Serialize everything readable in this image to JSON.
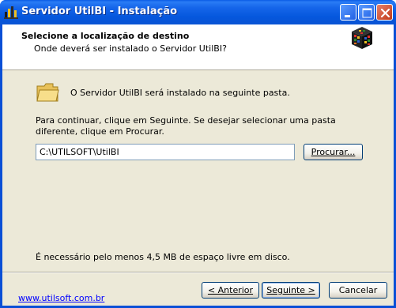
{
  "window": {
    "title": "Servidor UtilBI - Instalação"
  },
  "header": {
    "title": "Selecione a localização de destino",
    "subtitle": "Onde deverá ser instalado o Servidor UtilBI?"
  },
  "body": {
    "install_text": "O Servidor UtilBI será instalado na seguinte pasta.",
    "continue_text": "Para continuar, clique em Seguinte. Se desejar selecionar uma pasta diferente, clique em Procurar.",
    "path_value": "C:\\UTILSOFT\\UtilBI",
    "browse_label": "Procurar...",
    "space_text": "É necessário pelo menos 4,5 MB de espaço livre em disco."
  },
  "footer": {
    "link_text": "www.utilsoft.com.br",
    "back_label": "< Anterior",
    "next_label": "Seguinte >",
    "cancel_label": "Cancelar"
  },
  "icons": {
    "app": "app-icon",
    "minimize": "minimize-icon",
    "maximize": "maximize-icon",
    "close": "close-icon",
    "logo": "rubik-cube-icon",
    "folder": "folder-icon"
  },
  "colors": {
    "titlebar": "#0a5be6",
    "client_bg": "#ece9d8",
    "link": "#0000ff",
    "close_button": "#c13a18"
  }
}
